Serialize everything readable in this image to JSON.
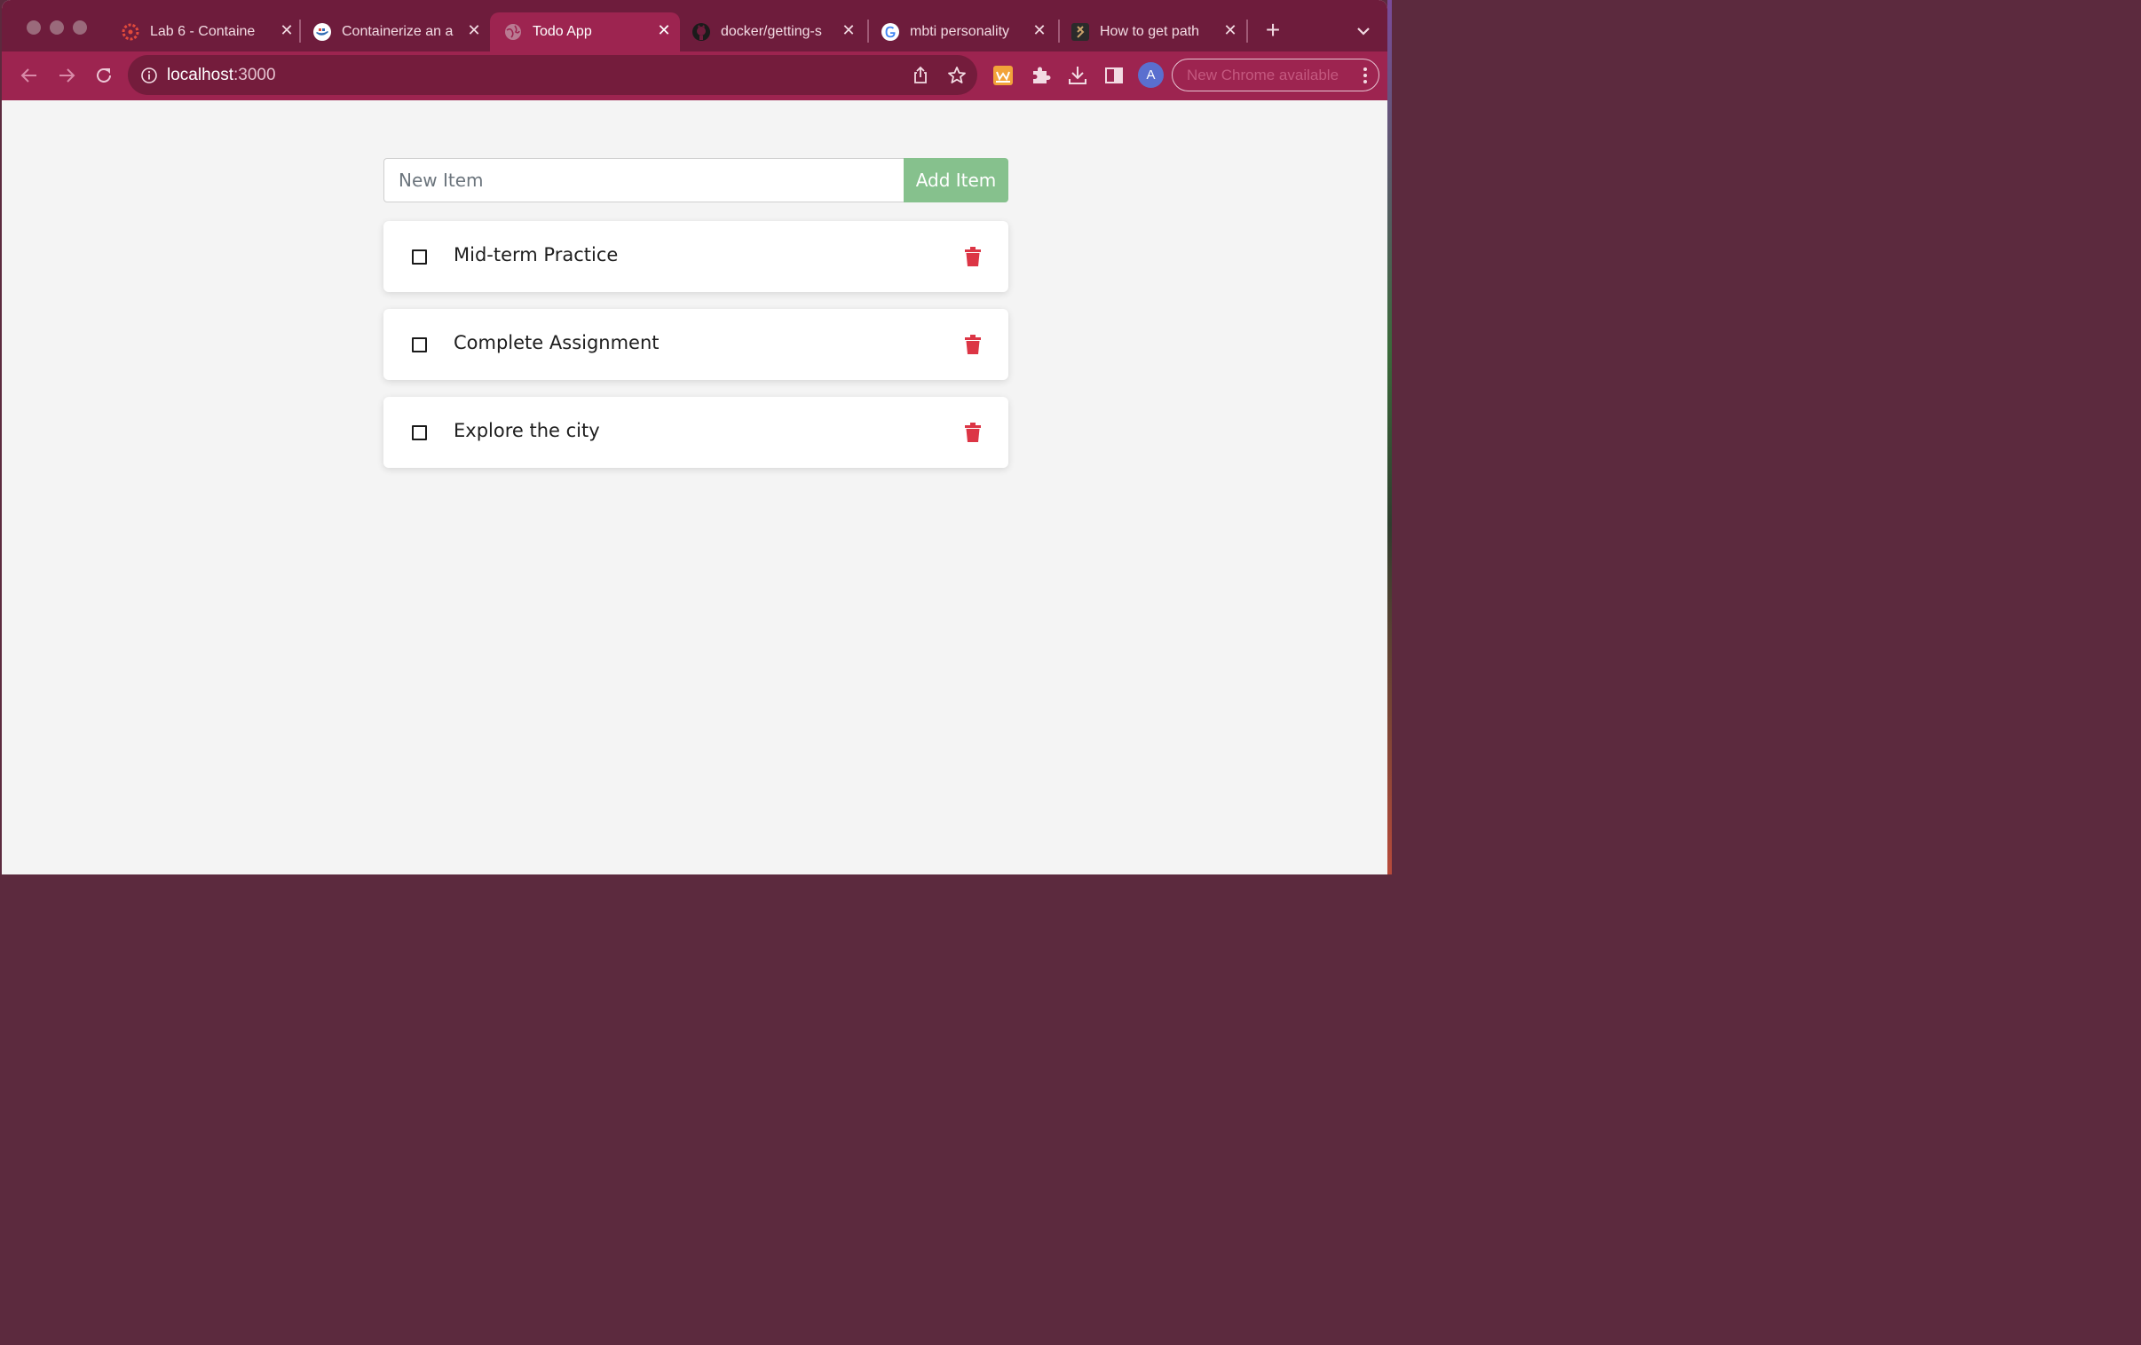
{
  "browser": {
    "tabs": [
      {
        "title": "Lab 6 - Containe",
        "favicon": "canvas-icon",
        "active": false
      },
      {
        "title": "Containerize an a",
        "favicon": "docker-icon",
        "active": false
      },
      {
        "title": "Todo App",
        "favicon": "globe-icon",
        "active": true
      },
      {
        "title": "docker/getting-s",
        "favicon": "github-icon",
        "active": false
      },
      {
        "title": "mbti personality",
        "favicon": "google-icon",
        "active": false
      },
      {
        "title": "How to get path",
        "favicon": "site-icon",
        "active": false
      }
    ],
    "url_host": "localhost",
    "url_port": ":3000",
    "avatar_letter": "A",
    "update_label": "New Chrome available",
    "accent_color": "#9d2450"
  },
  "app": {
    "input_placeholder": "New Item",
    "add_button_label": "Add Item",
    "items": [
      {
        "name": "Mid-term Practice",
        "completed": false
      },
      {
        "name": "Complete Assignment",
        "completed": false
      },
      {
        "name": "Explore the city",
        "completed": false
      }
    ],
    "delete_icon_color": "#dc3545",
    "button_color": "#86c18d"
  }
}
